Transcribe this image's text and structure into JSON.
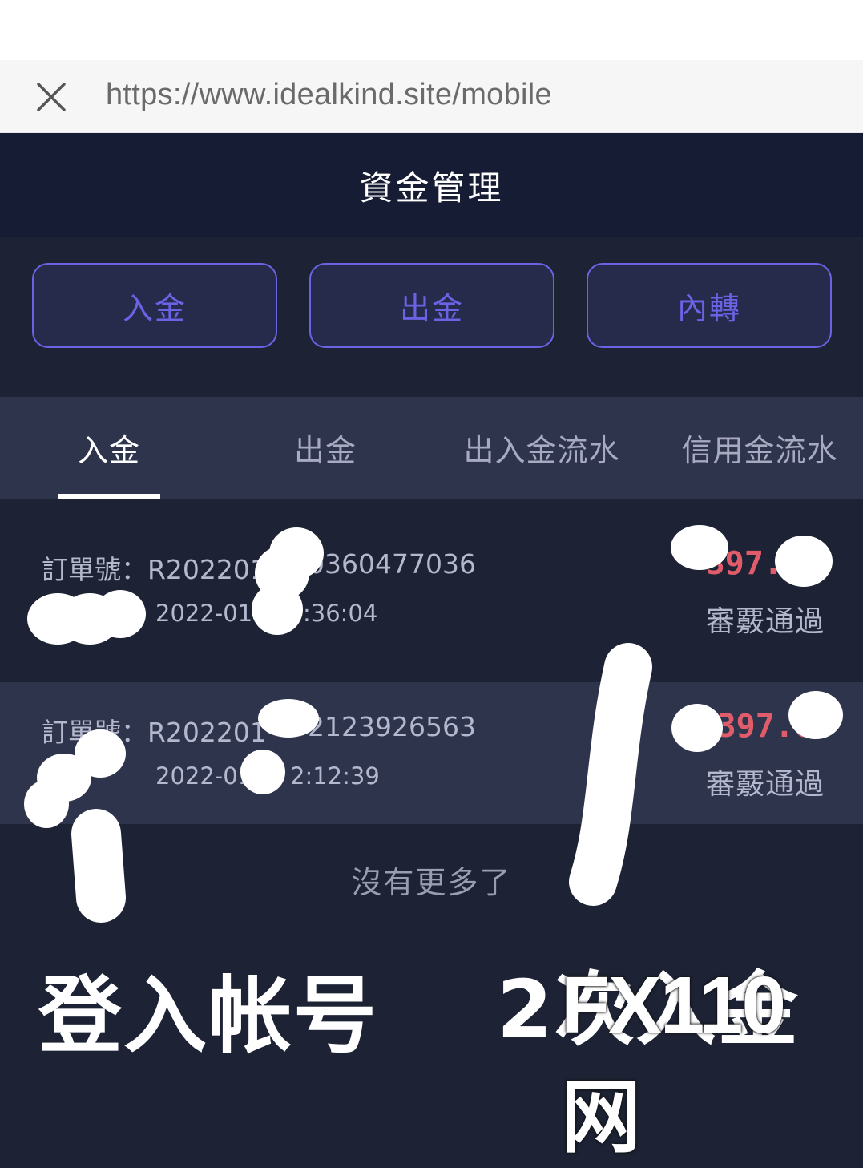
{
  "browser": {
    "url": "https://www.idealkind.site/mobile",
    "close_icon": "close-icon"
  },
  "header": {
    "title": "資金管理"
  },
  "actions": [
    {
      "label": "入金"
    },
    {
      "label": "出金"
    },
    {
      "label": "內轉"
    }
  ],
  "tabs": [
    {
      "label": "入金",
      "active": true
    },
    {
      "label": "出金",
      "active": false
    },
    {
      "label": "出入金流水",
      "active": false
    },
    {
      "label": "信用金流水",
      "active": false
    }
  ],
  "records": [
    {
      "order_label": "訂單號：R202201",
      "order_suffix": "0360477036",
      "date_prefix": "2022-01-1",
      "time_suffix": ":36:04",
      "amount": "397.",
      "status": "審覈通過"
    },
    {
      "order_label": "訂單號：R202201",
      "order_suffix": "2123926563",
      "date_prefix": "2022-01",
      "time_suffix": "2:12:39",
      "amount": "397.6",
      "status": "審覈通過"
    }
  ],
  "list_footer": "沒有更多了",
  "annotations": {
    "left": "登入帐号",
    "right": "2次入金"
  },
  "watermark": "FX110网",
  "colors": {
    "accent": "#6b63e6",
    "amount": "#e15c6a",
    "header_bg": "#151c33",
    "page_bg": "#1d2335",
    "tab_bg": "#2e344c"
  }
}
